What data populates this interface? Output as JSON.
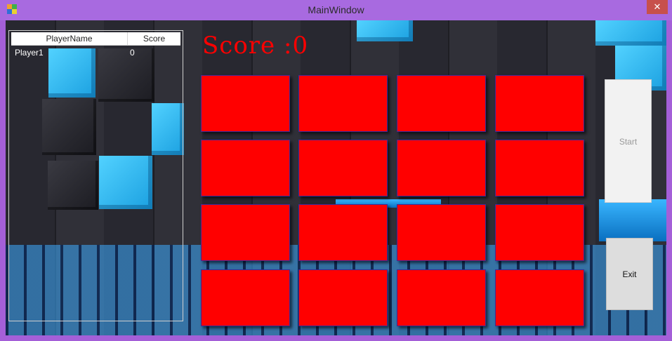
{
  "window": {
    "title": "MainWindow",
    "close_symbol": "✕"
  },
  "scoreboard": {
    "columns": [
      "PlayerName",
      "Score"
    ],
    "rows": [
      {
        "name": "Player1",
        "score": "0"
      }
    ]
  },
  "score_label": "Score :0",
  "cards": {
    "rows": 4,
    "cols": 4,
    "color": "#ff0000"
  },
  "buttons": {
    "start": "Start",
    "exit": "Exit"
  },
  "icons": {
    "app": "app-icon",
    "close": "close-icon"
  }
}
